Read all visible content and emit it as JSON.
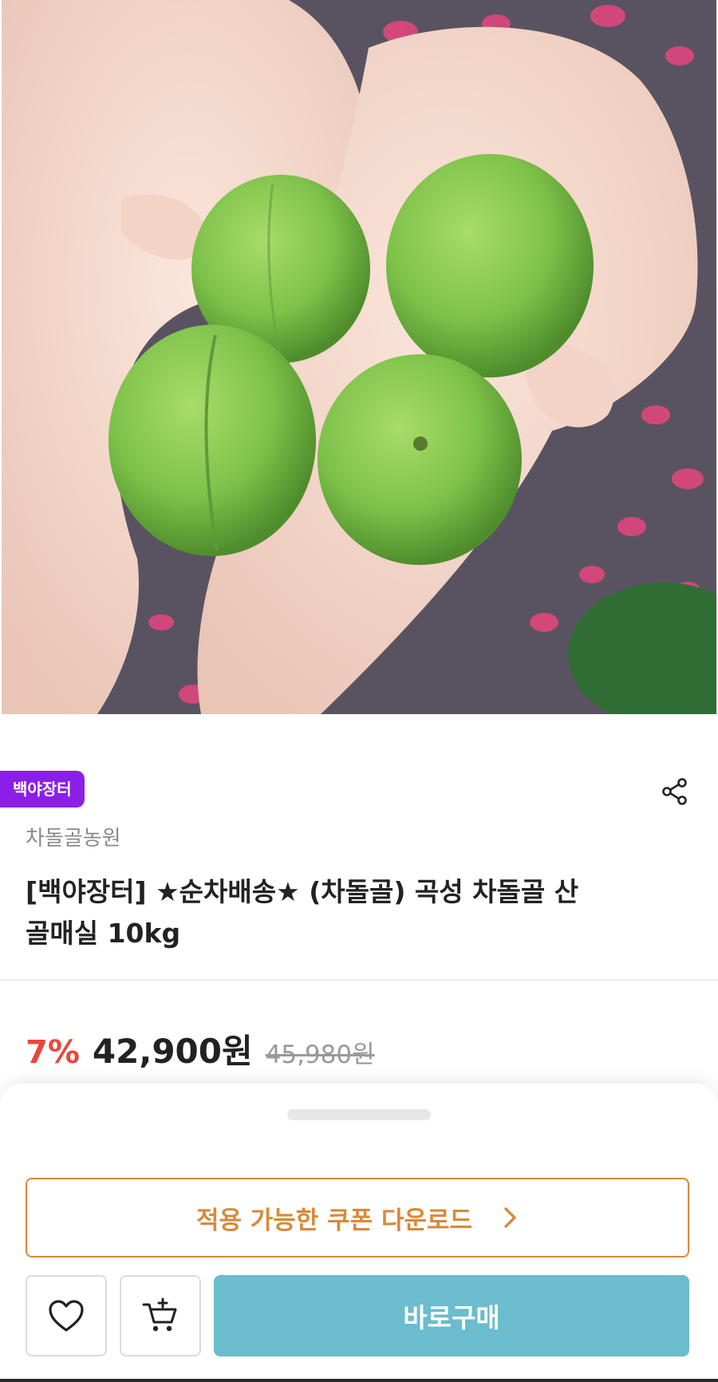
{
  "product": {
    "seller_badge": "백야장터",
    "farm_name": "차돌골농원",
    "title": "[백야장터] ★순차배송★ (차돌골) 곡성 차돌골 산골매실 10kg"
  },
  "price": {
    "discount": "7%",
    "sale_price": "42,900원",
    "original_price": "45,980원"
  },
  "actions": {
    "coupon_label": "적용 가능한 쿠폰 다운로드",
    "buy_label": "바로구매"
  },
  "icons": {
    "share": "share-icon",
    "coupon_arrow": "chevron-right-icon",
    "like": "heart-icon",
    "cart": "add-to-cart-icon"
  },
  "colors": {
    "seller_badge": "#8b1fe8",
    "discount": "#e8483c",
    "coupon_accent": "#d88a3a",
    "buy_button": "#6bbccd"
  }
}
